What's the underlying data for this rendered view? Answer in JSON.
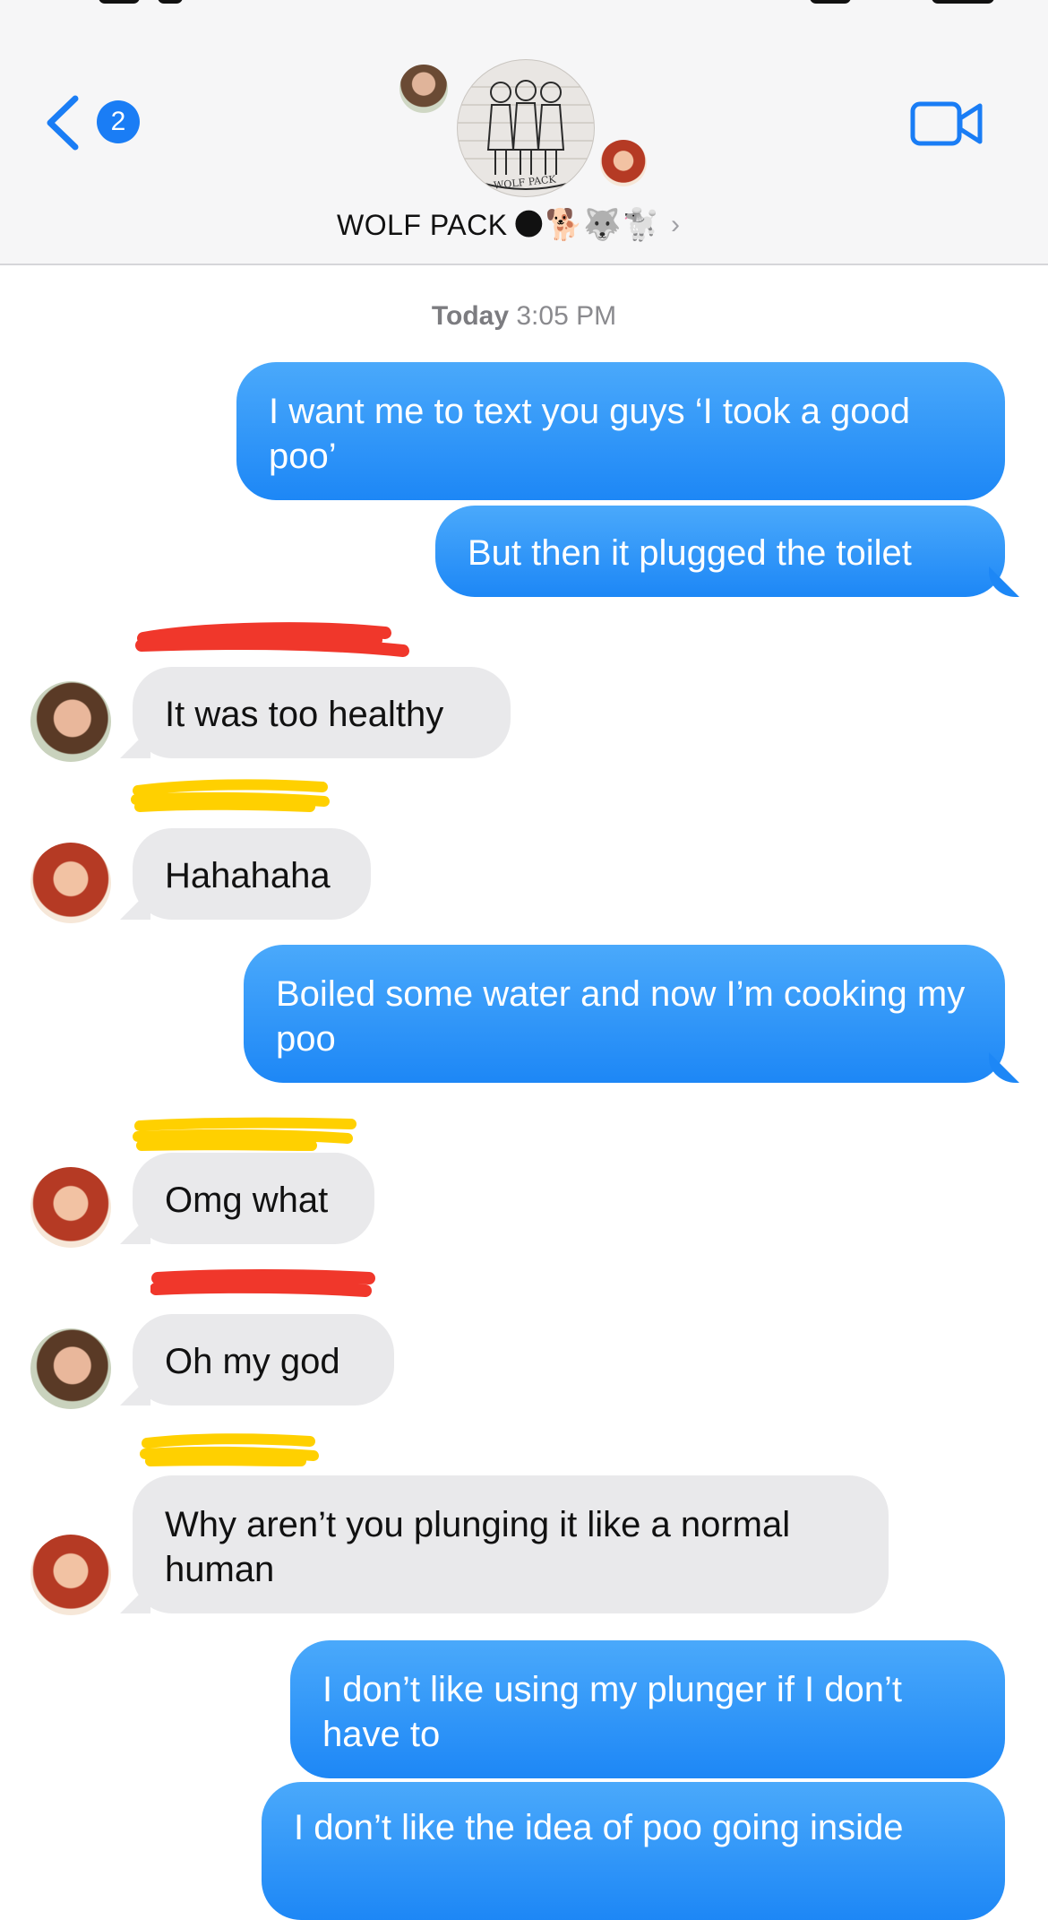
{
  "header": {
    "back_badge": "2",
    "group_name": "WOLF PACK",
    "group_emojis": "🌑🐕🐺🐩",
    "chevron": "›",
    "group_avatar_caption": "WOLF PACK"
  },
  "thread": {
    "timestamp_day": "Today",
    "timestamp_time": "3:05 PM",
    "messages": [
      {
        "direction": "out",
        "text": "I want me to text you guys ‘I took a good poo’"
      },
      {
        "direction": "out",
        "text": "But then it plugged the toilet"
      },
      {
        "direction": "in",
        "sender_avatar": "avatar-a",
        "text": "It was too healthy"
      },
      {
        "direction": "in",
        "sender_avatar": "avatar-b",
        "text": "Hahahaha"
      },
      {
        "direction": "out",
        "text": "Boiled some water and now I’m cooking my poo"
      },
      {
        "direction": "in",
        "sender_avatar": "avatar-b",
        "text": "Omg what"
      },
      {
        "direction": "in",
        "sender_avatar": "avatar-a",
        "text": "Oh my god"
      },
      {
        "direction": "in",
        "sender_avatar": "avatar-b",
        "text": "Why aren’t you plunging it like a normal human"
      },
      {
        "direction": "out",
        "text": "I don’t like using my plunger if I don’t have to"
      },
      {
        "direction": "out",
        "text": "I don’t like the idea of poo going inside"
      }
    ]
  },
  "colors": {
    "outgoing_bubble": "#1d87f6",
    "incoming_bubble": "#e9e9eb",
    "accent": "#1a7df5",
    "redaction_red": "#f0372b",
    "redaction_yellow": "#ffd000"
  },
  "icons": [
    "back-chevron-icon",
    "video-camera-icon",
    "chevron-right-icon"
  ]
}
